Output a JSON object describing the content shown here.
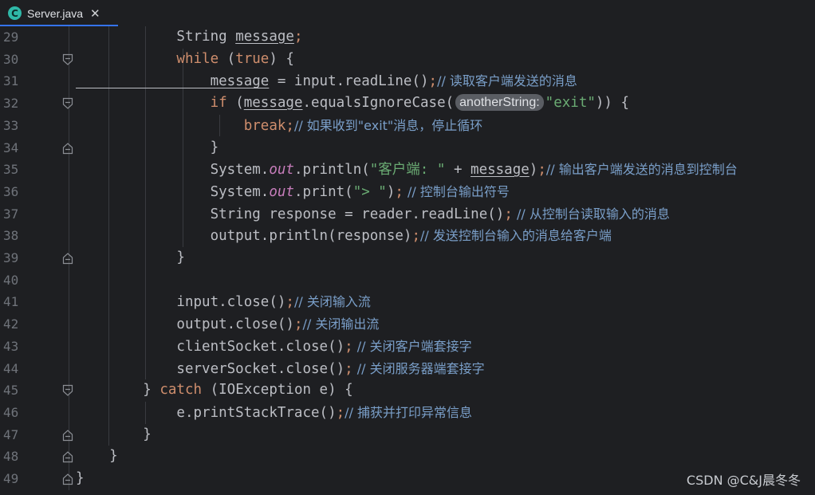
{
  "tab": {
    "filename": "Server.java",
    "icon": "java-class-icon",
    "icon_letter": "C",
    "close_glyph": "✕"
  },
  "colors": {
    "background": "#1e1f22",
    "keyword": "#cf8e6d",
    "string": "#6aab73",
    "comment": "#7a9fc9",
    "field": "#c77dbb",
    "text": "#bcbec4",
    "line_number": "#6f737a"
  },
  "lines": [
    {
      "n": "29",
      "fold": "",
      "tokens": [
        [
          "t",
          "            String "
        ],
        [
          "tu",
          "message"
        ],
        [
          "kw",
          ";"
        ]
      ]
    },
    {
      "n": "30",
      "fold": "open",
      "tokens": [
        [
          "kw",
          "            while"
        ],
        [
          "t",
          " ("
        ],
        [
          "kw",
          "true"
        ],
        [
          "t",
          ") {"
        ]
      ]
    },
    {
      "n": "31",
      "fold": "",
      "tokens": [
        [
          "tu",
          "                message"
        ],
        [
          "t",
          " = input.readLine()"
        ],
        [
          "kw",
          ";"
        ],
        [
          "cm",
          "// 读取客户端发送的消息"
        ]
      ]
    },
    {
      "n": "32",
      "fold": "open",
      "tokens": [
        [
          "kw",
          "                if"
        ],
        [
          "t",
          " ("
        ],
        [
          "tu",
          "message"
        ],
        [
          "t",
          ".equalsIgnoreCase("
        ],
        [
          "hint",
          "anotherString:"
        ],
        [
          "str",
          "\"exit\""
        ],
        [
          "t",
          ")) {"
        ]
      ]
    },
    {
      "n": "33",
      "fold": "",
      "tokens": [
        [
          "kw",
          "                    break;"
        ],
        [
          "cm",
          "// 如果收到\"exit\"消息，停止循环"
        ]
      ]
    },
    {
      "n": "34",
      "fold": "close",
      "tokens": [
        [
          "t",
          "                }"
        ]
      ]
    },
    {
      "n": "35",
      "fold": "",
      "tokens": [
        [
          "t",
          "                System."
        ],
        [
          "fld",
          "out"
        ],
        [
          "t",
          ".println("
        ],
        [
          "str",
          "\"客户端: \""
        ],
        [
          "t",
          " + "
        ],
        [
          "tu",
          "message"
        ],
        [
          "t",
          ")"
        ],
        [
          "kw",
          ";"
        ],
        [
          "cm",
          "// 输出客户端发送的消息到控制台"
        ]
      ]
    },
    {
      "n": "36",
      "fold": "",
      "tokens": [
        [
          "t",
          "                System."
        ],
        [
          "fld",
          "out"
        ],
        [
          "t",
          ".print("
        ],
        [
          "str",
          "\"> \""
        ],
        [
          "t",
          ")"
        ],
        [
          "kw",
          ";"
        ],
        [
          "cm",
          " // 控制台输出符号"
        ]
      ]
    },
    {
      "n": "37",
      "fold": "",
      "tokens": [
        [
          "t",
          "                String response = reader.readLine()"
        ],
        [
          "kw",
          ";"
        ],
        [
          "cm",
          " // 从控制台读取输入的消息"
        ]
      ]
    },
    {
      "n": "38",
      "fold": "",
      "tokens": [
        [
          "t",
          "                output.println(response)"
        ],
        [
          "kw",
          ";"
        ],
        [
          "cm",
          "// 发送控制台输入的消息给客户端"
        ]
      ]
    },
    {
      "n": "39",
      "fold": "close",
      "tokens": [
        [
          "t",
          "            }"
        ]
      ]
    },
    {
      "n": "40",
      "fold": "",
      "tokens": []
    },
    {
      "n": "41",
      "fold": "",
      "tokens": [
        [
          "t",
          "            input.close()"
        ],
        [
          "kw",
          ";"
        ],
        [
          "cm",
          "// 关闭输入流"
        ]
      ]
    },
    {
      "n": "42",
      "fold": "",
      "tokens": [
        [
          "t",
          "            output.close()"
        ],
        [
          "kw",
          ";"
        ],
        [
          "cm",
          "// 关闭输出流"
        ]
      ]
    },
    {
      "n": "43",
      "fold": "",
      "tokens": [
        [
          "t",
          "            clientSocket.close()"
        ],
        [
          "kw",
          ";"
        ],
        [
          "cm",
          " // 关闭客户端套接字"
        ]
      ]
    },
    {
      "n": "44",
      "fold": "",
      "tokens": [
        [
          "t",
          "            serverSocket.close()"
        ],
        [
          "kw",
          ";"
        ],
        [
          "cm",
          " // 关闭服务器端套接字"
        ]
      ]
    },
    {
      "n": "45",
      "fold": "open",
      "tokens": [
        [
          "t",
          "        } "
        ],
        [
          "kw",
          "catch"
        ],
        [
          "t",
          " (IOException e) {"
        ]
      ]
    },
    {
      "n": "46",
      "fold": "",
      "tokens": [
        [
          "t",
          "            e.printStackTrace()"
        ],
        [
          "kw",
          ";"
        ],
        [
          "cm",
          "// 捕获并打印异常信息"
        ]
      ]
    },
    {
      "n": "47",
      "fold": "close",
      "tokens": [
        [
          "t",
          "        }"
        ]
      ]
    },
    {
      "n": "48",
      "fold": "close",
      "tokens": [
        [
          "t",
          "    }"
        ]
      ]
    },
    {
      "n": "49",
      "fold": "close",
      "tokens": [
        [
          "t",
          "}"
        ]
      ]
    }
  ],
  "watermark": "CSDN @C&J晨冬冬"
}
